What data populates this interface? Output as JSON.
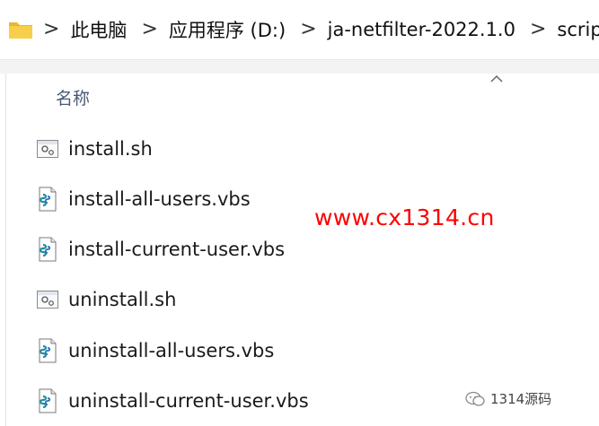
{
  "address_bar": {
    "breadcrumbs": [
      "此电脑",
      "应用程序 (D:)",
      "ja-netfilter-2022.1.0",
      "scripts"
    ],
    "separator": ">"
  },
  "file_list": {
    "column_header": "名称",
    "files": [
      {
        "name": "install.sh",
        "icon": "shell-script-file-icon"
      },
      {
        "name": "install-all-users.vbs",
        "icon": "vbscript-file-icon"
      },
      {
        "name": "install-current-user.vbs",
        "icon": "vbscript-file-icon"
      },
      {
        "name": "uninstall.sh",
        "icon": "shell-script-file-icon"
      },
      {
        "name": "uninstall-all-users.vbs",
        "icon": "vbscript-file-icon"
      },
      {
        "name": "uninstall-current-user.vbs",
        "icon": "vbscript-file-icon"
      }
    ]
  },
  "overlay": {
    "watermark_text": "www.cx1314.cn",
    "badge_text": "1314源码"
  },
  "colors": {
    "watermark": "#ff0000",
    "folder": "#f0c030",
    "header_text": "#4a5a75"
  }
}
